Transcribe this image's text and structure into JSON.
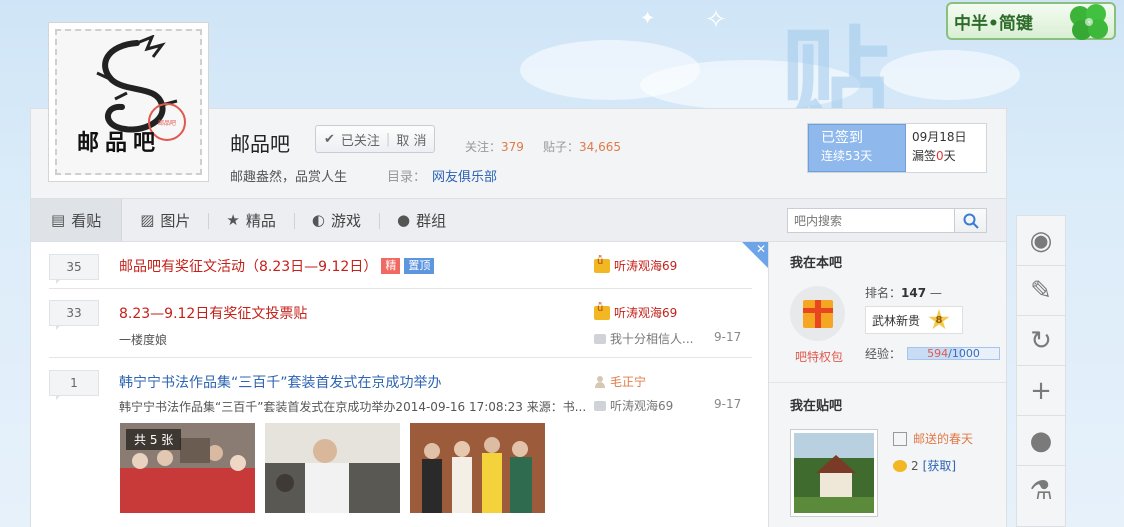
{
  "ime": {
    "label": "中半•简键"
  },
  "forum": {
    "logo_text": "邮品吧",
    "name": "邮品吧",
    "follow_label": "已关注",
    "cancel_label": "取 消",
    "followers_label": "关注：",
    "followers": "379",
    "posts_label": "贴子：",
    "posts": "34,665",
    "slogan": "邮趣盎然，品赏人生",
    "catalog_label": "目录：",
    "catalog_value": "网友俱乐部"
  },
  "sign": {
    "status": "已签到",
    "streak": "连续53天",
    "date": "09月18日",
    "missed_prefix": "漏签",
    "missed_count": "0",
    "missed_suffix": "天"
  },
  "tabs": [
    {
      "label": "看贴",
      "icon": "post-icon"
    },
    {
      "label": "图片",
      "icon": "image-icon"
    },
    {
      "label": "精品",
      "icon": "star-icon"
    },
    {
      "label": "游戏",
      "icon": "gamepad-icon"
    },
    {
      "label": "群组",
      "icon": "chat-icon"
    }
  ],
  "search": {
    "placeholder": "吧内搜索"
  },
  "threads": [
    {
      "replies": "35",
      "title": "邮品吧有奖征文活动（8.23日—9.12日）",
      "badges": [
        "精",
        "置顶"
      ],
      "author": "听涛观海69"
    },
    {
      "replies": "33",
      "title": "8.23—9.12日有奖征文投票贴",
      "subtitle": "一楼度娘",
      "author": "听涛观海69",
      "last_reply": "我十分相信人...",
      "last_date": "9-17"
    },
    {
      "replies": "1",
      "title": "韩宁宁书法作品集“三百千”套装首发式在京成功举办",
      "subtitle": "韩宁宁书法作品集“三百千”套装首发式在京成功举办2014-09-16 17:08:23 来源：书...",
      "author": "毛正宁",
      "last_reply": "听涛观海69",
      "last_date": "9-17",
      "photo_count": "共 5 张"
    }
  ],
  "aside": {
    "my_forum_title": "我在本吧",
    "privilege_label": "吧特权包",
    "rank_label": "排名：",
    "rank_value": "147",
    "rank_trend": "—",
    "level_name": "武林新贵",
    "level_num": "8",
    "exp_label": "经验：",
    "exp_current": "594",
    "exp_total": "/1000",
    "exp_fraction": 0.594,
    "my_posts_title": "我在贴吧",
    "username": "邮送的春天",
    "bean_count": "2",
    "get_label": "[获取]"
  },
  "colors": {
    "accent_blue": "#2d64b3",
    "title_red": "#c4211a",
    "orange": "#e07a48",
    "sign_blue": "#8fb9ed"
  }
}
